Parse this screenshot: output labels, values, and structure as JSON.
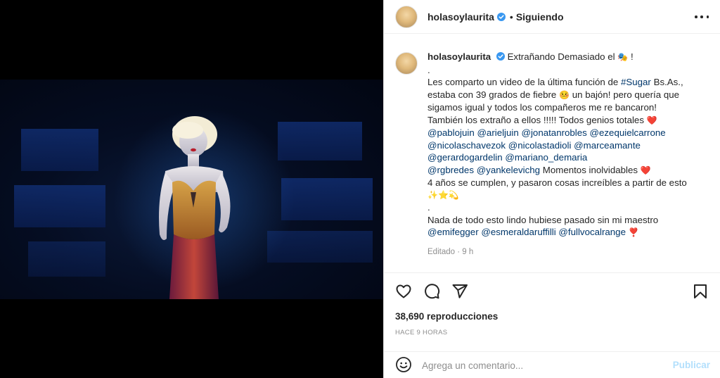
{
  "post": {
    "username": "holasoylaurita",
    "dot": "•",
    "follow_status": "Siguiendo",
    "caption": {
      "username": "holasoylaurita",
      "line1_text": "Extrañando Demasiado el",
      "line1_emoji": "🎭",
      "line1_end": "!",
      "line2": ".",
      "line3_a": "Les comparto un video de la última función de ",
      "line3_hashtag": "#Sugar",
      "line3_b": " Bs.As.,",
      "line4_a": "estaba con 39 grados de fiebre",
      "line4_emoji": "🤒",
      "line4_b": "un bajón! pero quería que",
      "line5": "sigamos igual y todos los compañeros me re bancaron!",
      "line6_a": "También los extraño a ellos !!!!! Todos genios totales",
      "line6_emoji": "❤️",
      "mentions_row1": [
        "@pablojuin",
        "@arieljuin",
        "@jonatanrobles",
        "@ezequielcarrone"
      ],
      "mentions_row2": [
        "@nicolaschavezok",
        "@nicolastadioli",
        "@marceamante"
      ],
      "mentions_row3": [
        "@gerardogardelin",
        "@mariano_demaria"
      ],
      "mentions_row4": [
        "@rgbredes",
        "@yankelevichg"
      ],
      "line_moments": "Momentos inolvidables",
      "line_moments_emoji": "❤️",
      "line_years": "4 años se cumplen, y pasaron cosas increíbles a partir de esto",
      "line_years_emojis": "✨⭐💫",
      "line_dot2": ".",
      "line_teacher": "Nada de todo esto lindo hubiese pasado sin mi maestro",
      "mentions_row5": [
        "@emifegger",
        "@esmeraldaruffilli",
        "@fullvocalrange"
      ],
      "mentions_row5_emoji": "❣️",
      "meta": "Editado · 9 h"
    },
    "views": "38,690 reproducciones",
    "time_ago": "HACE 9 HORAS",
    "comment": {
      "placeholder": "Agrega un comentario...",
      "publish_label": "Publicar"
    }
  },
  "icons": {
    "verified": "verified-badge-icon",
    "more": "more-options-icon",
    "like": "heart-icon",
    "comment": "comment-icon",
    "share": "share-icon",
    "save": "bookmark-icon",
    "emoji": "emoji-icon"
  },
  "colors": {
    "link": "#00376b",
    "verified": "#3897f0",
    "publish_disabled": "#b2dffc",
    "muted": "#8e8e8e"
  }
}
